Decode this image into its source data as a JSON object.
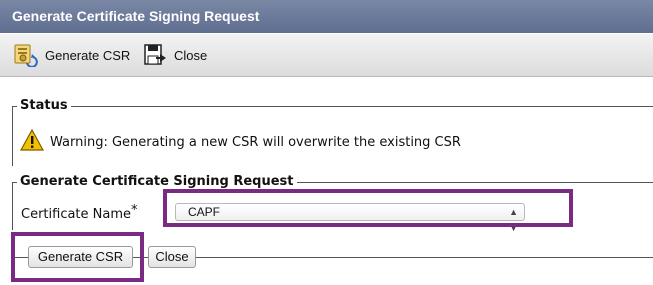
{
  "window": {
    "title": "Generate Certificate Signing Request"
  },
  "toolbar": {
    "generate_label": "Generate CSR",
    "close_label": "Close"
  },
  "status": {
    "legend": "Status",
    "message": "Warning: Generating a new CSR will overwrite the existing CSR"
  },
  "csr_form": {
    "legend": "Generate Certificate Signing Request",
    "certificate_name_label": "Certificate Name",
    "required_marker": "*",
    "certificate_name_value": "CAPF"
  },
  "actions": {
    "generate_label": "Generate CSR",
    "close_label": "Close"
  },
  "colors": {
    "titlebar": "#6b7a99",
    "highlight": "#7b2a83",
    "warning": "#f2c200"
  },
  "icons": {
    "generate": "generate-csr-icon",
    "close": "close-icon",
    "warning": "warning-icon",
    "select_arrows": "select-arrows-icon"
  }
}
